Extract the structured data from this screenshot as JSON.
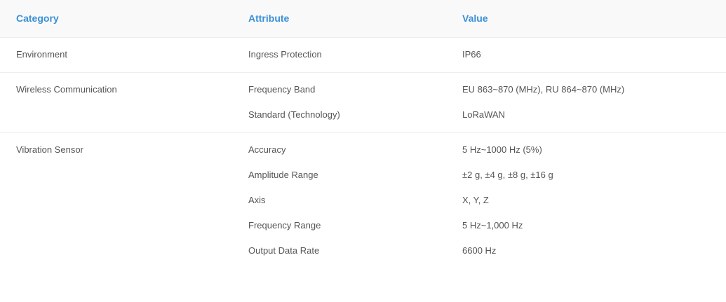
{
  "headers": {
    "category": "Category",
    "attribute": "Attribute",
    "value": "Value"
  },
  "groups": [
    {
      "category": "Environment",
      "rows": [
        {
          "attribute": "Ingress Protection",
          "value": "IP66"
        }
      ]
    },
    {
      "category": "Wireless Communication",
      "rows": [
        {
          "attribute": "Frequency Band",
          "value": "EU 863~870 (MHz), RU 864~870 (MHz)"
        },
        {
          "attribute": "Standard (Technology)",
          "value": "LoRaWAN"
        }
      ]
    },
    {
      "category": "Vibration Sensor",
      "rows": [
        {
          "attribute": "Accuracy",
          "value": "5 Hz~1000 Hz (5%)"
        },
        {
          "attribute": "Amplitude Range",
          "value": "±2 g, ±4 g, ±8 g, ±16 g"
        },
        {
          "attribute": "Axis",
          "value": "X, Y, Z"
        },
        {
          "attribute": "Frequency Range",
          "value": "5 Hz~1,000 Hz"
        },
        {
          "attribute": "Output Data Rate",
          "value": "6600 Hz"
        }
      ]
    }
  ],
  "colors": {
    "header_text": "#3a90d6",
    "header_bg": "#f9f9f9",
    "body_text": "#555555",
    "divider": "#eeeeee"
  }
}
